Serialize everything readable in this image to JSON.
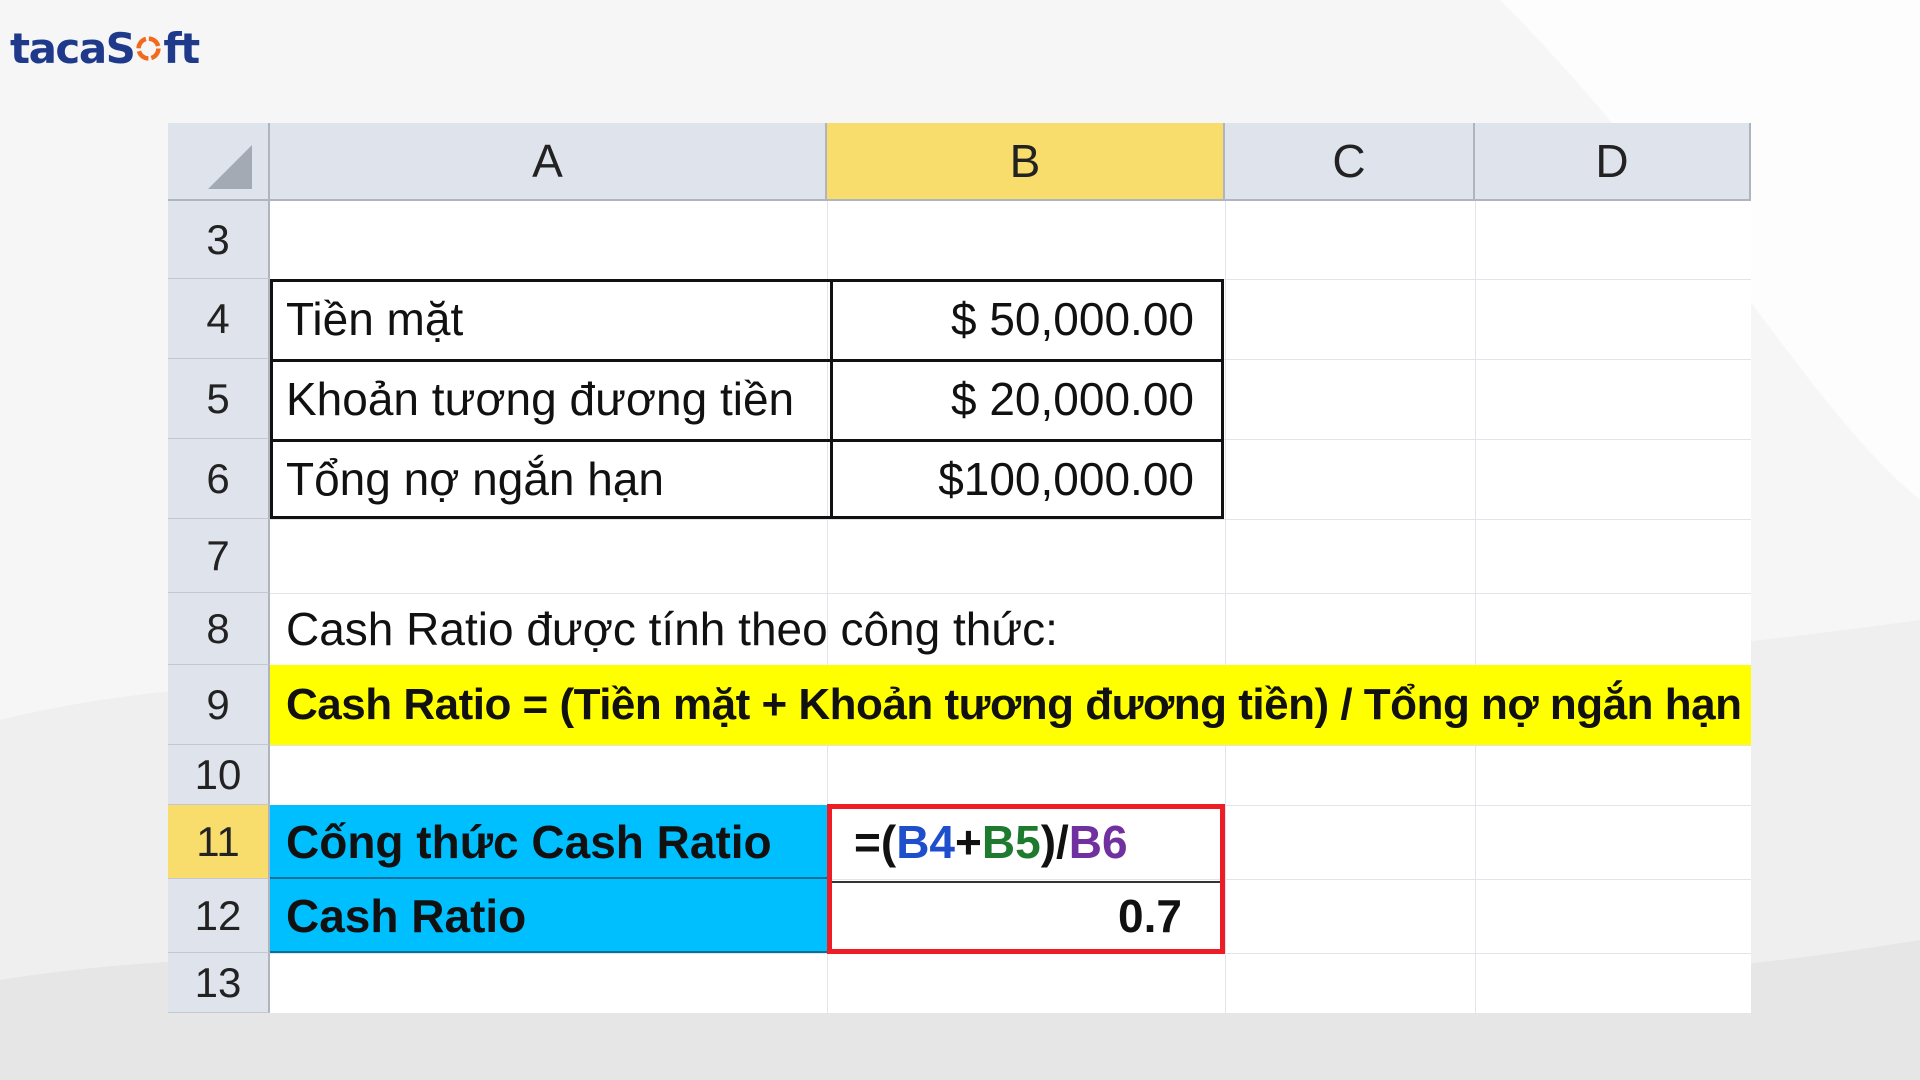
{
  "logo": {
    "text_pre": "tacaS",
    "text_post": "ft",
    "accent_color": "#f26b1d",
    "brand_color": "#1f3a8a"
  },
  "sheet": {
    "columns": [
      "A",
      "B",
      "C",
      "D"
    ],
    "selected_column": "B",
    "rows": [
      "3",
      "4",
      "5",
      "6",
      "7",
      "8",
      "9",
      "10",
      "11",
      "12",
      "13"
    ],
    "selected_row": "11"
  },
  "table": {
    "rows": [
      {
        "label": "Tiền mặt",
        "value": "$ 50,000.00"
      },
      {
        "label": "Khoản tương đương tiền",
        "value": "$ 20,000.00"
      },
      {
        "label": "Tổng nợ ngắn hạn",
        "value": "$100,000.00"
      }
    ]
  },
  "formula_intro": "Cash Ratio được tính theo công thức:",
  "formula_text": "Cash Ratio = (Tiền mặt + Khoản tương đương tiền) / Tổng nợ ngắn hạn",
  "calc": {
    "formula_label": "Cống thức Cash Ratio",
    "formula_parts": {
      "p1": "=(",
      "b4": "B4",
      "plus": "+",
      "b5": "B5",
      "p2": ")/",
      "b6": "B6"
    },
    "result_label": "Cash Ratio",
    "result_value": "0.7"
  },
  "colors": {
    "highlight_yellow": "#ffff00",
    "header_selected": "#f8dc6c",
    "label_blue": "#00bfff",
    "result_border_red": "#ee1c25"
  }
}
